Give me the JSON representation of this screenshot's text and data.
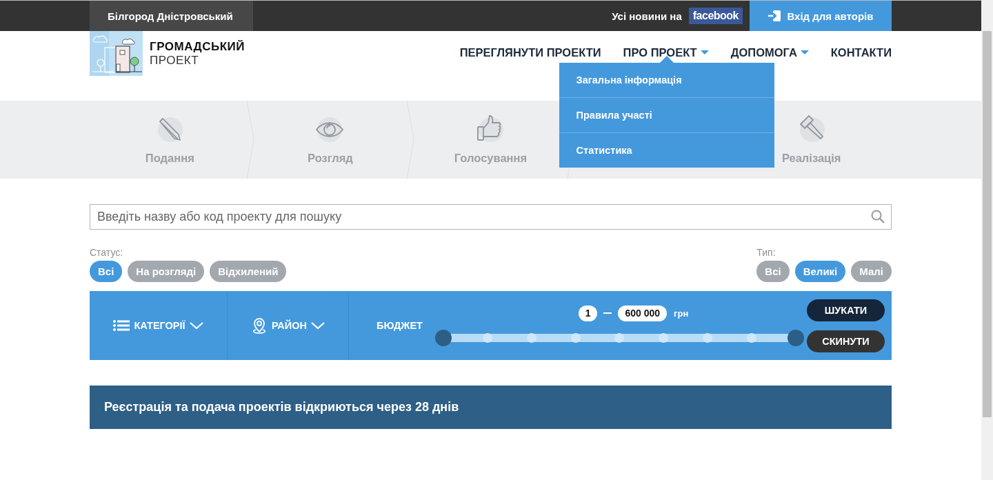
{
  "top_bar": {
    "city": "Білгород Дністровський",
    "news_label": "Усі новини на",
    "news_link": "facebook",
    "login_button": "Вхід для авторів"
  },
  "logo": {
    "line_1": "ГРОМАДСЬКИЙ",
    "line_2": "ПРОЕКТ"
  },
  "nav": [
    {
      "label": "ПЕРЕГЛЯНУТИ ПРОЕКТИ",
      "has_menu": false
    },
    {
      "label": "ПРО ПРОЕКТ",
      "has_menu": true,
      "menu": [
        "Загальна інформація",
        "Правила участі",
        "Статистика"
      ]
    },
    {
      "label": "ДОПОМОГА",
      "has_menu": true
    },
    {
      "label": "КОНТАКТИ",
      "has_menu": false
    }
  ],
  "steps": [
    {
      "label": "Подання",
      "kind": "pencil"
    },
    {
      "label": "Розгляд",
      "kind": "eye"
    },
    {
      "label": "Голосування",
      "kind": "thumb"
    },
    {
      "label": "Реалізація",
      "kind": "gavel"
    }
  ],
  "search": {
    "placeholder": "Введіть назву або код проекту для пошуку"
  },
  "status_filter": {
    "label": "Статус:",
    "options": [
      {
        "label": "Всі",
        "selected": true
      },
      {
        "label": "На розгляді",
        "selected": false
      },
      {
        "label": "Відхилений",
        "selected": false
      }
    ]
  },
  "type_filter": {
    "label": "Тип:",
    "options": [
      {
        "label": "Всі",
        "selected": false
      },
      {
        "label": "Великі",
        "selected": true
      },
      {
        "label": "Малі",
        "selected": false
      }
    ]
  },
  "filter_bar": {
    "categories": "КАТЕГОРІЇ",
    "district": "РАЙОН",
    "budget": "БЮДЖЕТ",
    "budget_min": "1",
    "budget_max": "600 000",
    "currency": "грн",
    "handles": [
      {
        "level": 0
      },
      {
        "level": 1
      }
    ],
    "search_button": "ШУКАТИ",
    "reset_button": "СКИНУТИ"
  },
  "banner": "Реєстрація та подача проектів відкриються через 28 днів"
}
